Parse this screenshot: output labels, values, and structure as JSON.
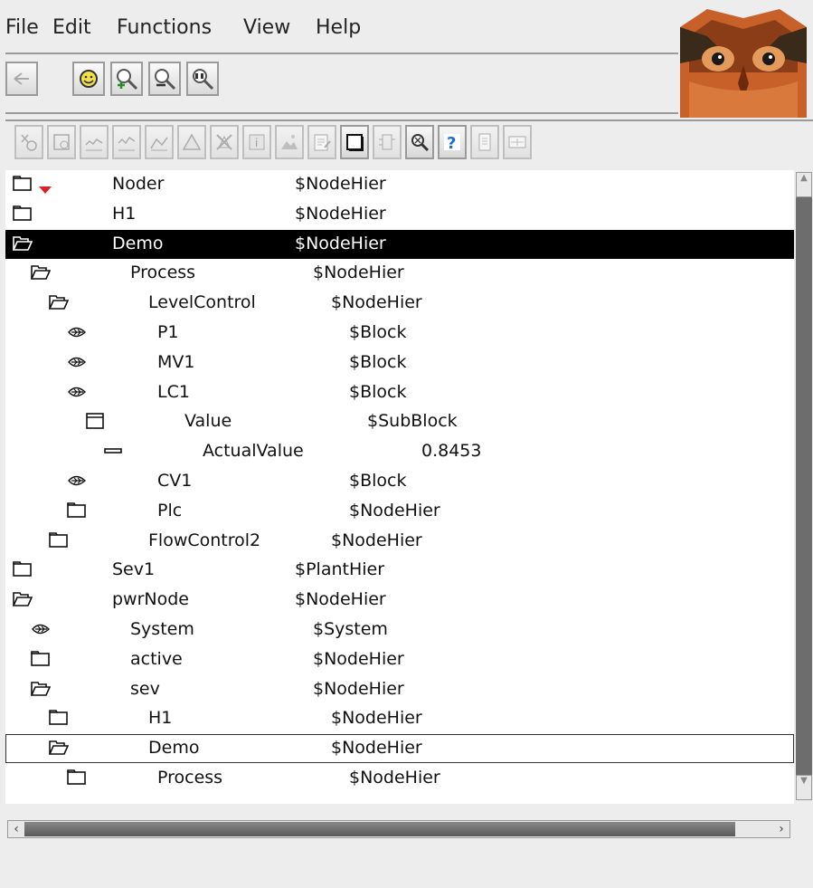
{
  "menu": {
    "file": "File",
    "edit": "Edit",
    "functions": "Functions",
    "view": "View",
    "help": "Help"
  },
  "tree": [
    {
      "name": "Noder",
      "cls": "$NodeHier",
      "icon": "folder-closed-icon",
      "level": 0,
      "expand_marker": true
    },
    {
      "name": "H1",
      "cls": "$NodeHier",
      "icon": "folder-closed-icon",
      "level": 0
    },
    {
      "name": "Demo",
      "cls": "$NodeHier",
      "icon": "folder-open-icon",
      "level": 0,
      "selected": true
    },
    {
      "name": "Process",
      "cls": "$NodeHier",
      "icon": "folder-open-icon",
      "level": 1
    },
    {
      "name": "LevelControl",
      "cls": "$NodeHier",
      "icon": "folder-open-icon",
      "level": 2
    },
    {
      "name": "P1",
      "cls": "$Block",
      "icon": "leaf-icon",
      "level": 3
    },
    {
      "name": "MV1",
      "cls": "$Block",
      "icon": "leaf-icon",
      "level": 3
    },
    {
      "name": "LC1",
      "cls": "$Block",
      "icon": "leaf-icon",
      "level": 3
    },
    {
      "name": "Value",
      "cls": "$SubBlock",
      "icon": "window-icon",
      "level": 4
    },
    {
      "name": "ActualValue",
      "cls": "0.8453",
      "icon": "attribute-icon",
      "level": 5
    },
    {
      "name": "CV1",
      "cls": "$Block",
      "icon": "leaf-icon",
      "level": 3
    },
    {
      "name": "Plc",
      "cls": "$NodeHier",
      "icon": "folder-closed-icon",
      "level": 3
    },
    {
      "name": "FlowControl2",
      "cls": "$NodeHier",
      "icon": "folder-closed-icon",
      "level": 2
    },
    {
      "name": "Sev1",
      "cls": "$PlantHier",
      "icon": "folder-closed-icon",
      "level": 0
    },
    {
      "name": "pwrNode",
      "cls": "$NodeHier",
      "icon": "folder-open-icon",
      "level": 0
    },
    {
      "name": "System",
      "cls": "$System",
      "icon": "leaf-icon",
      "level": 1
    },
    {
      "name": "active",
      "cls": "$NodeHier",
      "icon": "folder-closed-icon",
      "level": 1
    },
    {
      "name": "sev",
      "cls": "$NodeHier",
      "icon": "folder-open-icon",
      "level": 1
    },
    {
      "name": "H1",
      "cls": "$NodeHier",
      "icon": "folder-closed-icon",
      "level": 2
    },
    {
      "name": "Demo",
      "cls": "$NodeHier",
      "icon": "folder-open-icon",
      "level": 2,
      "focused": true
    },
    {
      "name": "Process",
      "cls": "$NodeHier",
      "icon": "folder-closed-icon",
      "level": 3
    }
  ],
  "colors": {
    "selection": "#000000",
    "owl_body": "#c8602a",
    "marker": "#e02020"
  }
}
